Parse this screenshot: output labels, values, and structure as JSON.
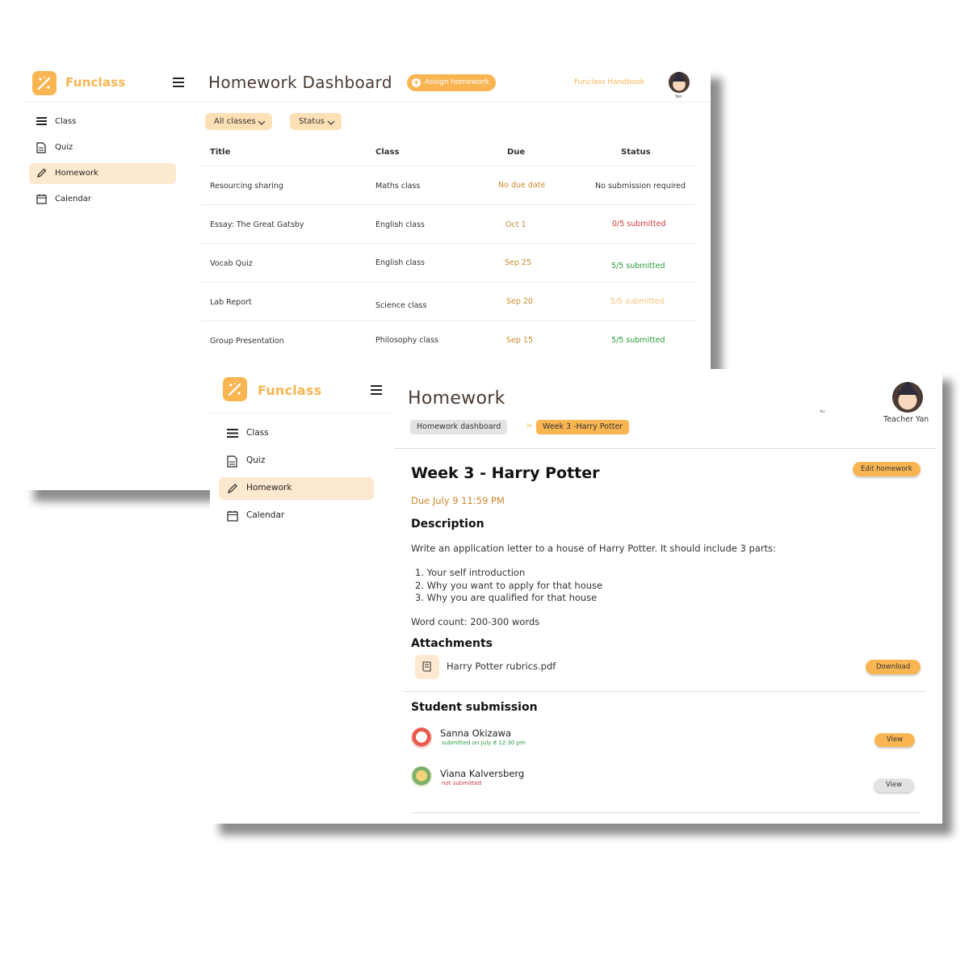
{
  "colors": {
    "accent": "#f9b552",
    "accent_light": "#fde9cf",
    "green": "#2a9d3a",
    "red": "#d33a3a",
    "amber": "#c8892a",
    "faded": "#f4c27a"
  },
  "dashboard": {
    "brand": "Funclass",
    "title": "Homework Dashboard",
    "assign_label": "Assign homework",
    "handbook_label": "Funclass Handbook",
    "avatar_name": "Yan",
    "nav": [
      {
        "label": "Class",
        "icon": "menu-lines-icon"
      },
      {
        "label": "Quiz",
        "icon": "document-icon"
      },
      {
        "label": "Homework",
        "icon": "pencil-icon"
      },
      {
        "label": "Calendar",
        "icon": "calendar-icon"
      }
    ],
    "filters": [
      "All classes",
      "Status"
    ],
    "columns": [
      "Title",
      "Class",
      "Due",
      "Status"
    ],
    "rows": [
      {
        "title": "Resourcing sharing",
        "class": "Maths class",
        "due": "No due date",
        "status": "No submission required"
      },
      {
        "title": "Essay: The Great Gatsby",
        "class": "English class",
        "due": "Oct 1",
        "status": "0/5 submitted"
      },
      {
        "title": "Vocab Quiz",
        "class": "English class",
        "due": "Sep 25",
        "status": "5/5 submitted"
      },
      {
        "title": "Lab Report",
        "class": "Science class",
        "due": "Sep 20",
        "status": "5/5 submitted"
      },
      {
        "title": "Group Presentation",
        "class": "Philosophy class",
        "due": "Sep 15",
        "status": "5/5 submitted"
      }
    ]
  },
  "detail": {
    "brand": "Funclass",
    "title": "Homework",
    "small_name": "Yan",
    "avatar_name": "Teacher Yan",
    "nav": [
      {
        "label": "Class",
        "icon": "menu-lines-icon"
      },
      {
        "label": "Quiz",
        "icon": "document-icon"
      },
      {
        "label": "Homework",
        "icon": "pencil-icon"
      },
      {
        "label": "Calendar",
        "icon": "calendar-icon"
      }
    ],
    "breadcrumb": {
      "home": "Homework dashboard",
      "separator": ">",
      "current": "Week 3 -Harry Potter"
    },
    "hw_title": "Week 3 - Harry Potter",
    "edit_label": "Edit homework",
    "due": "Due July 9   11:59 PM",
    "description_heading": "Description",
    "description": "Write an application letter to a house of Harry Potter. It should include 3 parts:",
    "parts": [
      "1. Your self introduction",
      "2. Why you want to apply for that house",
      "3. Why you are qualified for that house"
    ],
    "word_count": "Word count: 200-300 words",
    "attachments_heading": "Attachments",
    "attachment_name": "Harry Potter rubrics.pdf",
    "download_label": "Download",
    "submission_heading": "Student submission",
    "students": [
      {
        "name": "Sanna Okizawa",
        "status": "submitted on July 8 12:30 pm",
        "view": "View"
      },
      {
        "name": "Viana Kalversberg",
        "status": "not submitted",
        "view": "View"
      }
    ]
  }
}
